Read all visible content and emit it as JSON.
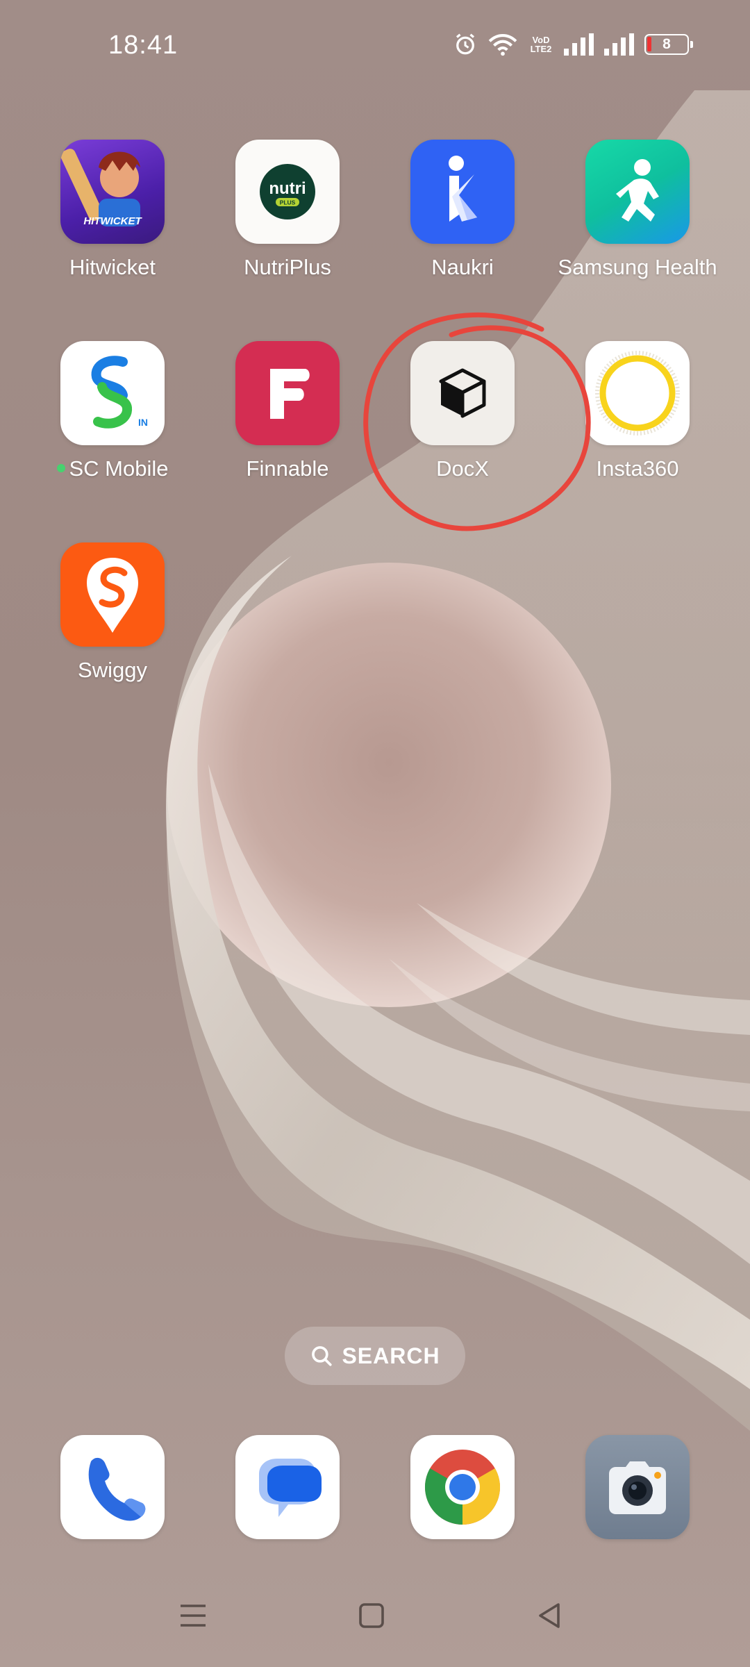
{
  "status_bar": {
    "time": "18:41",
    "network_badge": "VoD\nLTE2",
    "battery_level": "8",
    "icons": [
      "alarm-icon",
      "wifi-icon",
      "volte-icon",
      "signal-icon",
      "signal-icon",
      "battery-icon"
    ]
  },
  "apps": [
    {
      "label": "Hitwicket",
      "icon": "hitwicket-icon"
    },
    {
      "label": "NutriPlus",
      "icon": "nutriplus-icon",
      "logo_text": "nutri",
      "logo_sub": "PLUS"
    },
    {
      "label": "Naukri",
      "icon": "naukri-icon"
    },
    {
      "label": "Samsung Health",
      "icon": "samsung-health-icon"
    },
    {
      "label": "SC Mobile",
      "icon": "sc-mobile-icon",
      "logo_sub": "IN",
      "has_new_dot": true
    },
    {
      "label": "Finnable",
      "icon": "finnable-icon"
    },
    {
      "label": "DocX",
      "icon": "docx-cube-icon",
      "annotated": true
    },
    {
      "label": "Insta360",
      "icon": "insta360-icon"
    },
    {
      "label": "Swiggy",
      "icon": "swiggy-icon"
    }
  ],
  "hitwicket_logo_text": "HITWICKET",
  "search": {
    "label": "SEARCH"
  },
  "dock": [
    {
      "name": "phone",
      "icon": "phone-icon"
    },
    {
      "name": "messages",
      "icon": "messages-icon"
    },
    {
      "name": "chrome",
      "icon": "chrome-icon"
    },
    {
      "name": "camera",
      "icon": "camera-icon"
    }
  ],
  "nav": [
    "menu-icon",
    "home-icon",
    "back-icon"
  ],
  "colors": {
    "annotation_red": "#e8453c",
    "naukri_blue": "#2f62f4",
    "finnable_red": "#d42d52",
    "swiggy_orange": "#fc5a12",
    "insta360_yellow": "#f8d31c"
  }
}
